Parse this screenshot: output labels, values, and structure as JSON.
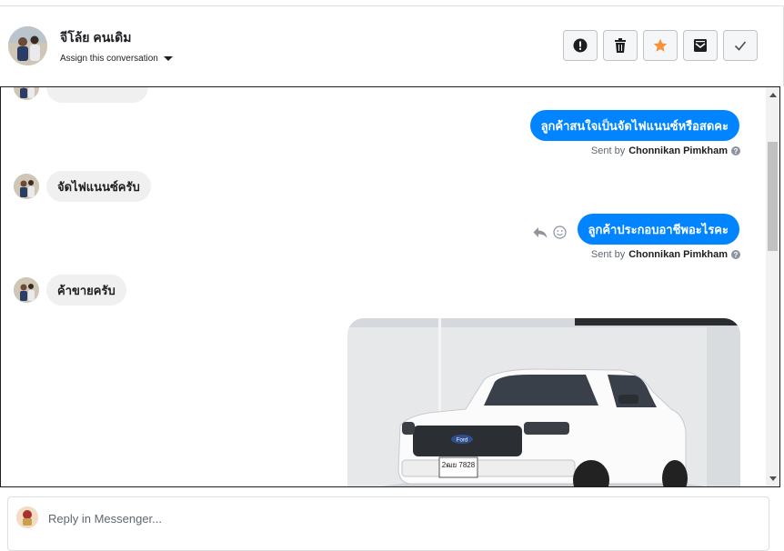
{
  "header": {
    "contact_name": "จีโล้ย คนเดิม",
    "assign_label": "Assign this conversation",
    "actions": [
      {
        "icon": "alert-icon",
        "label": "Mark as spam"
      },
      {
        "icon": "trash-icon",
        "label": "Delete"
      },
      {
        "icon": "star-icon",
        "label": "Star"
      },
      {
        "icon": "mark-unread-icon",
        "label": "Mark unread"
      },
      {
        "icon": "check-icon",
        "label": "Mark done"
      }
    ]
  },
  "messages": {
    "m1_text": "จัดไฟแนนซ์ครับ",
    "m2_text": "ลูกค้าสนใจเป็นจัดไฟแนนซ์หรือสดคะ",
    "m2_sent_prefix": "Sent by",
    "m2_sent_name": "Chonnikan Pimkham",
    "m3_text": "ลูกค้าประกอบอาชีพอะไรคะ",
    "m3_sent_prefix": "Sent by",
    "m3_sent_name": "Chonnikan Pimkham",
    "m4_text": "ค้าขายครับ",
    "photo_plate": "2ฒย 7828"
  },
  "composer": {
    "placeholder": "Reply in Messenger..."
  },
  "colors": {
    "accent": "#0084ff",
    "star": "#f7923b"
  }
}
